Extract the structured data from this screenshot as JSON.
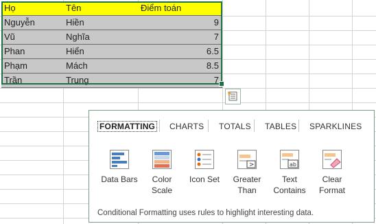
{
  "sheet": {
    "headers": [
      "Họ",
      "Tên",
      "Điểm toán"
    ],
    "rows": [
      {
        "ho": "Nguyễn",
        "ten": "Hiền",
        "diem": "9"
      },
      {
        "ho": "Vũ",
        "ten": "Nghĩa",
        "diem": "7"
      },
      {
        "ho": "Phan",
        "ten": "Hiển",
        "diem": "6.5"
      },
      {
        "ho": "Phạm",
        "ten": "Mách",
        "diem": "8.5"
      },
      {
        "ho": "Trần",
        "ten": "Trung",
        "diem": "7"
      }
    ]
  },
  "quick_analysis": {
    "tabs": [
      "FORMATTING",
      "CHARTS",
      "TOTALS",
      "TABLES",
      "SPARKLINES"
    ],
    "options": [
      {
        "label1": "Data Bars",
        "label2": "",
        "icon": "data-bars-icon"
      },
      {
        "label1": "Color",
        "label2": "Scale",
        "icon": "color-scale-icon"
      },
      {
        "label1": "Icon Set",
        "label2": "",
        "icon": "icon-set-icon"
      },
      {
        "label1": "Greater",
        "label2": "Than",
        "icon": "greater-than-icon"
      },
      {
        "label1": "Text",
        "label2": "Contains",
        "icon": "text-contains-icon"
      },
      {
        "label1": "Clear",
        "label2": "Format",
        "icon": "clear-format-icon"
      }
    ],
    "footer": "Conditional Formatting uses rules to highlight interesting data.",
    "colors": {
      "accent": "#1e7145",
      "header_fill": "#ffff00",
      "cell_fill": "#c8c8c8"
    }
  }
}
